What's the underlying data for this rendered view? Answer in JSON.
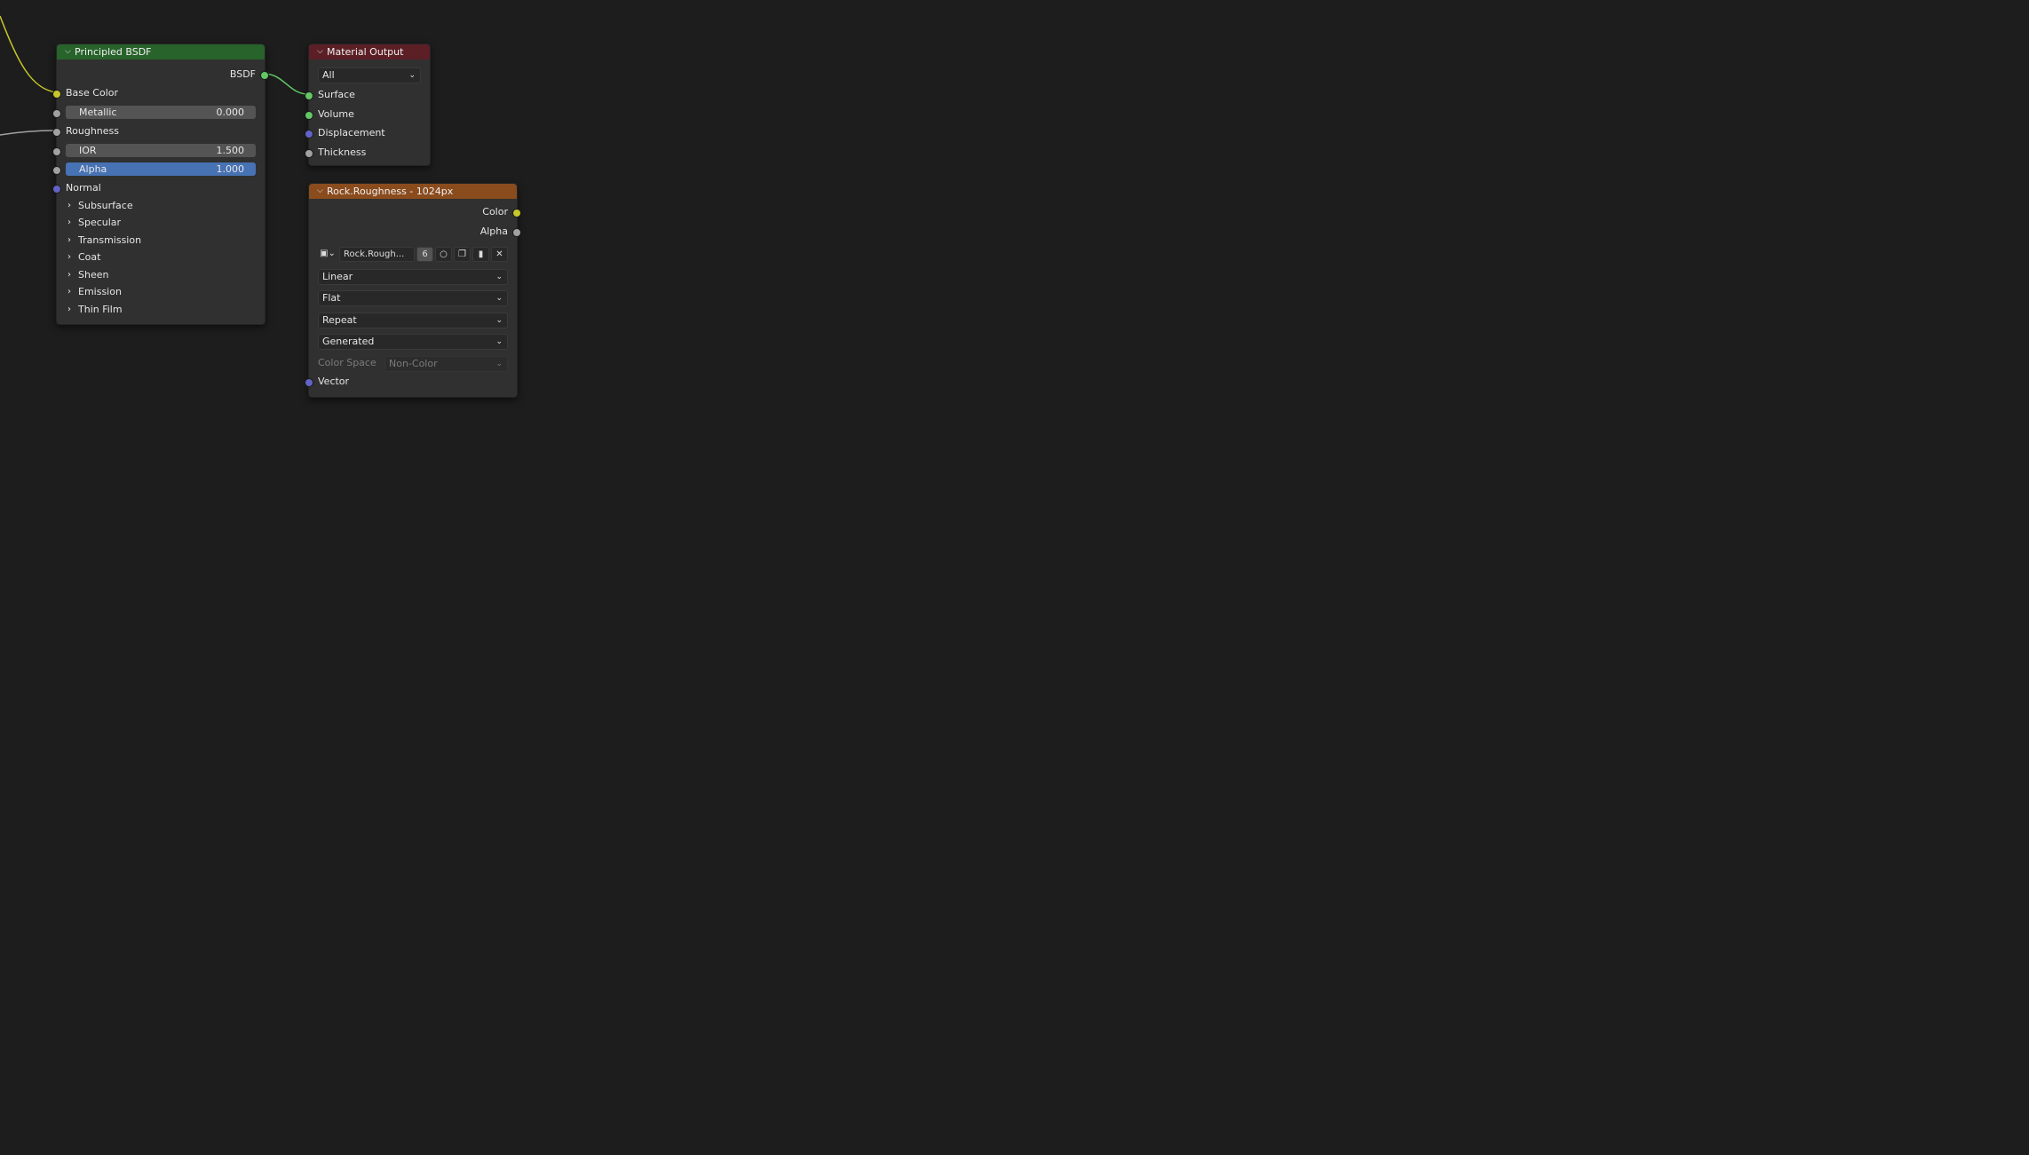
{
  "nodes": {
    "principled": {
      "title": "Principled BSDF",
      "header_color": "#27632a",
      "output": "BSDF",
      "inputs": {
        "base_color": "Base Color",
        "metallic_label": "Metallic",
        "metallic_value": "0.000",
        "roughness": "Roughness",
        "ior_label": "IOR",
        "ior_value": "1.500",
        "alpha_label": "Alpha",
        "alpha_value": "1.000",
        "normal": "Normal"
      },
      "panels": [
        "Subsurface",
        "Specular",
        "Transmission",
        "Coat",
        "Sheen",
        "Emission",
        "Thin Film"
      ]
    },
    "material_output": {
      "title": "Material Output",
      "header_color": "#5c1f26",
      "target": "All",
      "inputs": [
        "Surface",
        "Volume",
        "Displacement",
        "Thickness"
      ]
    },
    "image_texture": {
      "title": "Rock.Roughness - 1024px",
      "header_color": "#8a4b1d",
      "outputs": [
        "Color",
        "Alpha"
      ],
      "image_name": "Rock.Rough...",
      "users": "6",
      "interpolation": "Linear",
      "projection": "Flat",
      "extension": "Repeat",
      "source": "Generated",
      "color_space_label": "Color Space",
      "color_space_value": "Non-Color",
      "vector_input": "Vector"
    }
  },
  "socket_colors": {
    "color": "#c7c729",
    "float": "#a1a1a1",
    "shader": "#63c763",
    "vector": "#6363c7"
  },
  "icons": [
    "chevron-down-icon",
    "chevron-right-icon",
    "image-icon",
    "shield-icon",
    "duplicate-icon",
    "folder-icon",
    "close-icon"
  ]
}
